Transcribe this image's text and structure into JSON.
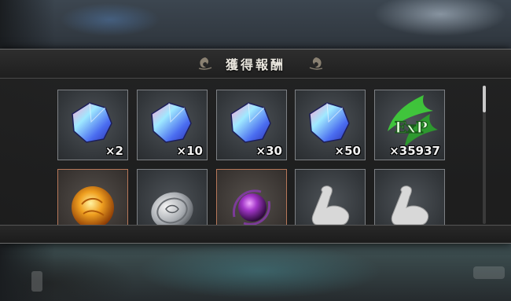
{
  "dialog": {
    "title": "獲得報酬"
  },
  "rewards": [
    {
      "icon": "crystal-icon",
      "quantity": "×2"
    },
    {
      "icon": "crystal-icon",
      "quantity": "×10"
    },
    {
      "icon": "crystal-icon",
      "quantity": "×30"
    },
    {
      "icon": "crystal-icon",
      "quantity": "×50"
    },
    {
      "icon": "exp-icon",
      "icon_text": "ExP",
      "quantity": "×35937"
    },
    {
      "icon": "fire-orb-icon",
      "quantity": ""
    },
    {
      "icon": "silver-coin-icon",
      "quantity": ""
    },
    {
      "icon": "dark-orb-icon",
      "quantity": ""
    },
    {
      "icon": "flexed-arm-icon",
      "quantity": ""
    },
    {
      "icon": "flexed-arm-icon",
      "quantity": ""
    }
  ],
  "colors": {
    "panel": "#222222",
    "cell_border": "#7d8084",
    "cell_border_highlight": "#b7785a",
    "text": "#f2f2f2"
  }
}
